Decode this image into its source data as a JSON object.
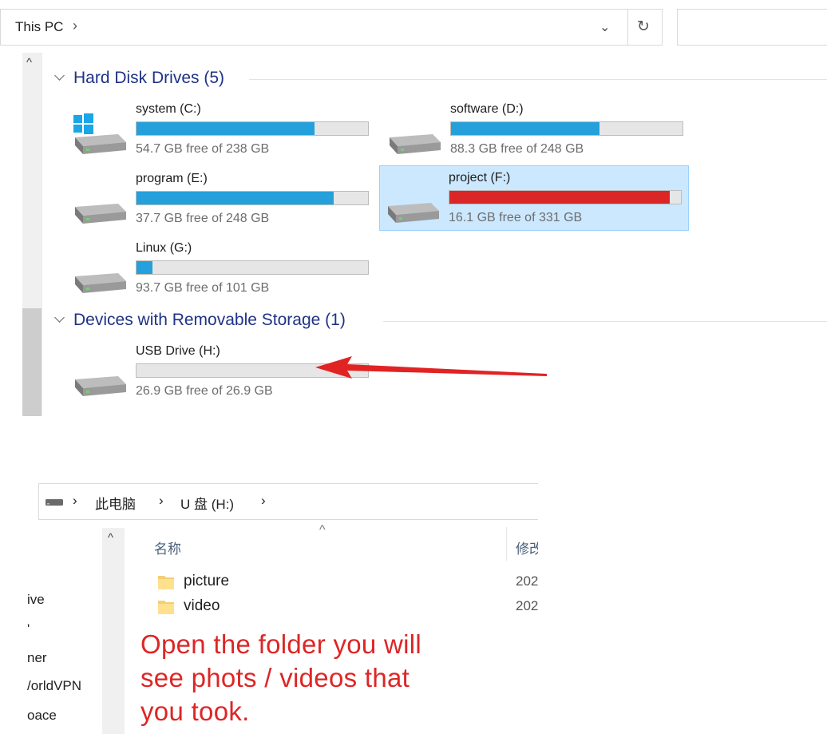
{
  "top_window": {
    "address": {
      "crumb": "This PC",
      "chevron": "›",
      "dropdown_icon": "⌄",
      "refresh_icon": "↻"
    },
    "groups": [
      {
        "title": "Hard Disk Drives (5)",
        "drives": [
          {
            "name": "system (C:)",
            "free_text": "54.7 GB free of 238 GB",
            "used_fraction": 0.77,
            "bar_color": "#26a0da",
            "icon": "windows-drive-icon"
          },
          {
            "name": "software (D:)",
            "free_text": "88.3 GB free of 248 GB",
            "used_fraction": 0.64,
            "bar_color": "#26a0da",
            "icon": "drive-icon"
          },
          {
            "name": "program (E:)",
            "free_text": "37.7 GB free of 248 GB",
            "used_fraction": 0.85,
            "bar_color": "#26a0da",
            "icon": "drive-icon"
          },
          {
            "name": "project (F:)",
            "free_text": "16.1 GB free of 331 GB",
            "used_fraction": 0.95,
            "bar_color": "#da2626",
            "icon": "drive-icon",
            "selected": true
          },
          {
            "name": "Linux (G:)",
            "free_text": "93.7 GB free of 101 GB",
            "used_fraction": 0.07,
            "bar_color": "#26a0da",
            "icon": "drive-icon"
          }
        ]
      },
      {
        "title": "Devices with Removable Storage (1)",
        "drives": [
          {
            "name": "USB Drive (H:)",
            "free_text": "26.9 GB free of 26.9 GB",
            "used_fraction": 0.0,
            "bar_color": "#26a0da",
            "icon": "drive-icon"
          }
        ]
      }
    ]
  },
  "bottom_window": {
    "breadcrumb": [
      "此电脑",
      "U 盘 (H:)"
    ],
    "nav_items": [
      "ive",
      "'",
      "ner",
      "/orldVPN",
      "oace"
    ],
    "columns": {
      "name": "名称",
      "date": "修改"
    },
    "files": [
      {
        "name": "picture",
        "date": "202"
      },
      {
        "name": "video",
        "date": "202"
      }
    ]
  },
  "annotation": {
    "lines": [
      "Open the folder you will",
      "see phots / videos that",
      "you took."
    ],
    "color": "#dd2626"
  }
}
